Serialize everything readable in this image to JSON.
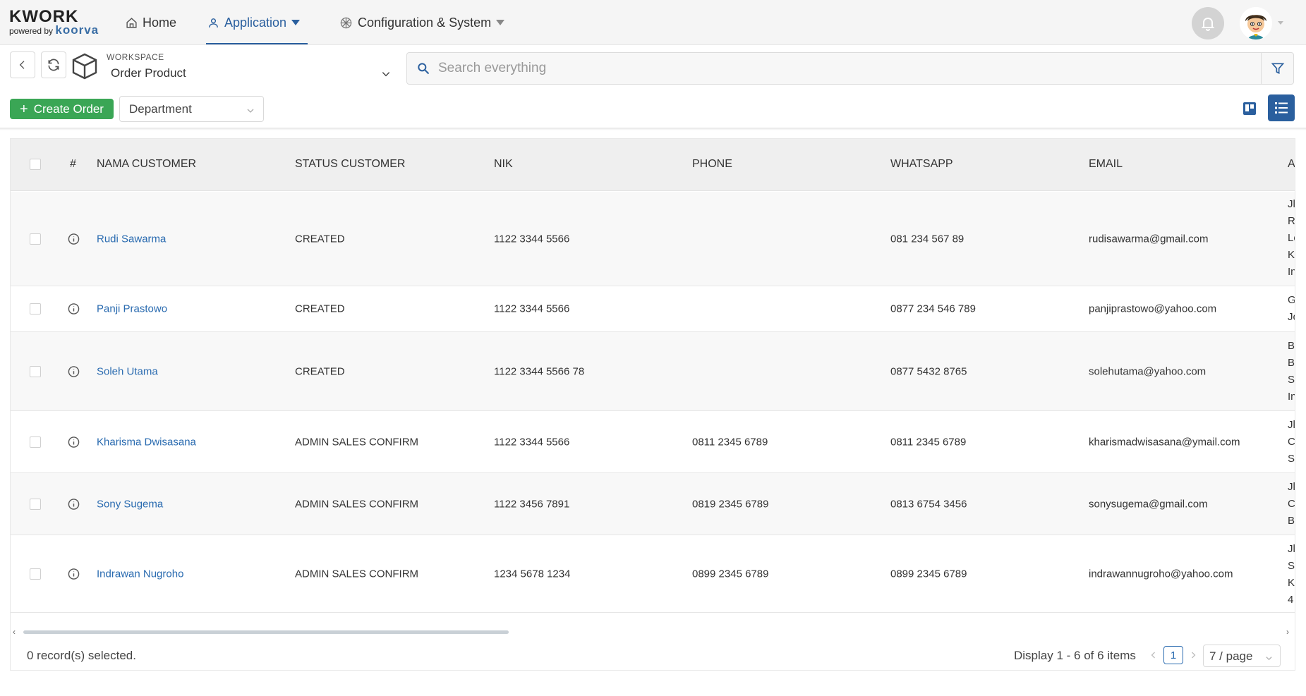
{
  "logo": {
    "main": "KWORK",
    "sub": "powered by",
    "brand": "koorva"
  },
  "nav": {
    "home": "Home",
    "application": "Application",
    "config": "Configuration & System"
  },
  "workspace": {
    "label": "WORKSPACE",
    "value": "Order Product"
  },
  "search": {
    "placeholder": "Search everything"
  },
  "toolbar": {
    "create_label": "Create Order",
    "department": "Department"
  },
  "table": {
    "headers": {
      "num": "#",
      "nama": "NAMA CUSTOMER",
      "status": "STATUS CUSTOMER",
      "nik": "NIK",
      "phone": "PHONE",
      "whatsapp": "WHATSAPP",
      "email": "EMAIL",
      "address": "A"
    },
    "rows": [
      {
        "nama": "Rudi Sawarma",
        "status": "CREATED",
        "nik": "1122 3344 5566",
        "phone": "",
        "whatsapp": "081 234 567 89",
        "email": "rudisawarma@gmail.com",
        "address": [
          "Jl",
          "R",
          "Lo",
          "K",
          "In"
        ]
      },
      {
        "nama": "Panji Prastowo",
        "status": "CREATED",
        "nik": "1122 3344 5566",
        "phone": "",
        "whatsapp": "0877 234 546 789",
        "email": "panjiprastowo@yahoo.com",
        "address": [
          "G",
          "Jo"
        ]
      },
      {
        "nama": "Soleh Utama",
        "status": "CREATED",
        "nik": "1122 3344 5566 78",
        "phone": "",
        "whatsapp": "0877 5432 8765",
        "email": "solehutama@yahoo.com",
        "address": [
          "B",
          "B",
          "Se",
          "In"
        ]
      },
      {
        "nama": "Kharisma Dwisasana",
        "status": "ADMIN SALES CONFIRM",
        "nik": "1122 3344 5566",
        "phone": "0811 2345 6789",
        "whatsapp": "0811 2345 6789",
        "email": "kharismadwisasana@ymail.com",
        "address": [
          "Jl",
          "C",
          "Se"
        ]
      },
      {
        "nama": "Sony Sugema",
        "status": "ADMIN SALES CONFIRM",
        "nik": "1122 3456 7891",
        "phone": "0819 2345 6789",
        "whatsapp": "0813 6754 3456",
        "email": "sonysugema@gmail.com",
        "address": [
          "Jl",
          "C",
          "B"
        ]
      },
      {
        "nama": "Indrawan Nugroho",
        "status": "ADMIN SALES CONFIRM",
        "nik": "1234 5678 1234",
        "phone": "0899 2345 6789",
        "whatsapp": "0899 2345 6789",
        "email": "indrawannugroho@yahoo.com",
        "address": [
          "Jl",
          "Sl",
          "Ka",
          "4"
        ]
      }
    ]
  },
  "footer": {
    "selected": "0 record(s) selected.",
    "display": "Display 1 - 6 of 6 items",
    "page": "1",
    "page_size": "7 / page"
  },
  "colors": {
    "primary": "#2a5f9e",
    "create": "#3aa655",
    "link": "#2a6bb0"
  }
}
